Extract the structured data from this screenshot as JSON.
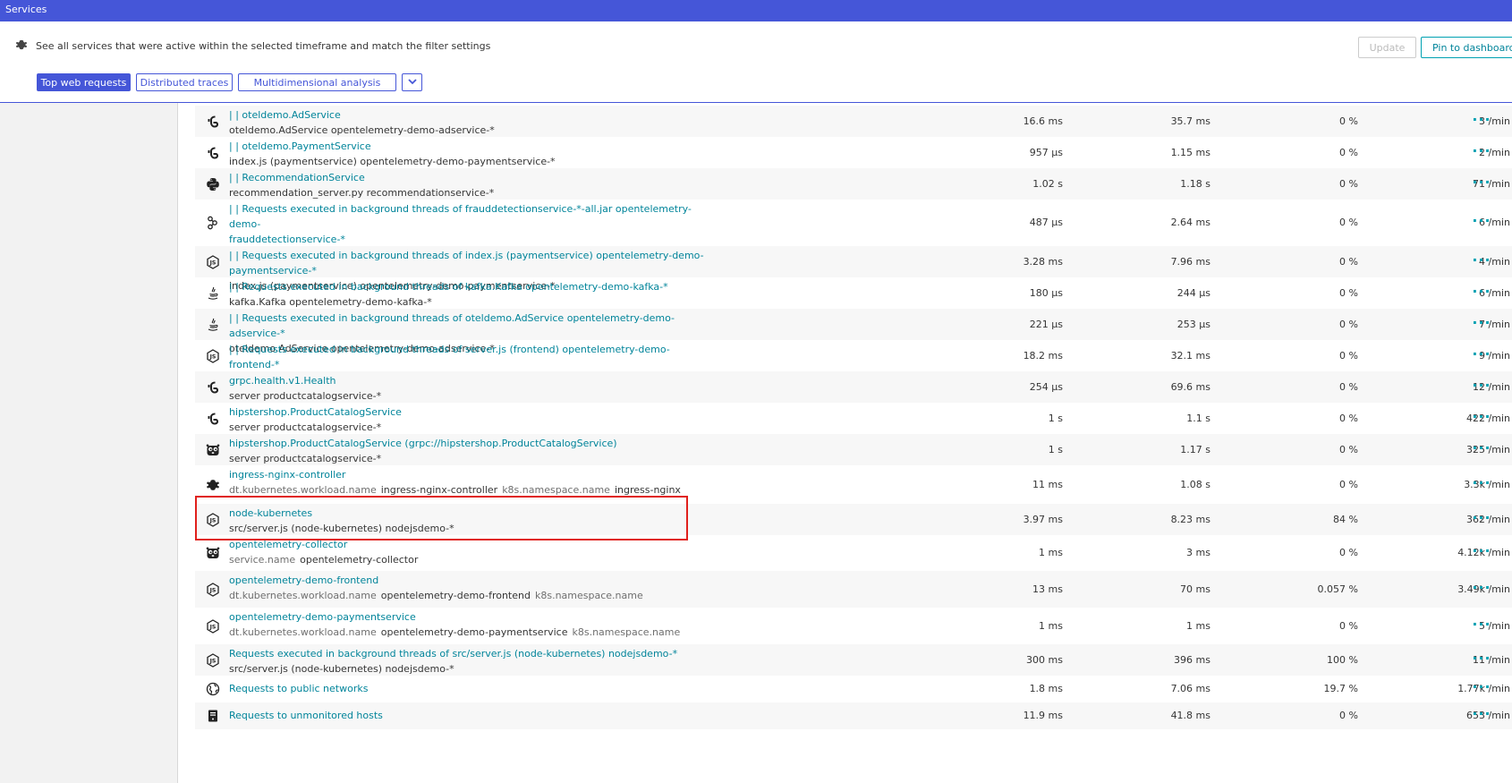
{
  "topbar": {
    "title": "Services"
  },
  "header": {
    "description": "See all services that were active within the selected timeframe and match the filter settings",
    "update_label": "Update",
    "pin_label": "Pin to dashboard",
    "tabs": [
      {
        "label": "Top web requests"
      },
      {
        "label": "Distributed traces"
      },
      {
        "label": "Multidimensional analysis"
      }
    ]
  },
  "colors": {
    "brand": "#4556d8",
    "link": "#00849a",
    "highlight": "#e0201c"
  },
  "rows": [
    {
      "icon": "grpc-icon",
      "name": "| | oteldemo.AdService",
      "sub": "oteldemo.AdService opentelemetry-demo-adservice-*",
      "c1": "16.6 ms",
      "c2": "35.7 ms",
      "c3": "0 %",
      "c4": "3 /min"
    },
    {
      "icon": "grpc-icon",
      "name": "| | oteldemo.PaymentService",
      "sub": "index.js (paymentservice) opentelemetry-demo-paymentservice-*",
      "c1": "957 µs",
      "c2": "1.15 ms",
      "c3": "0 %",
      "c4": "2 /min"
    },
    {
      "icon": "python-icon",
      "name": "| | RecommendationService",
      "sub": "recommendation_server.py recommendationservice-*",
      "c1": "1.02 s",
      "c2": "1.18 s",
      "c3": "0 %",
      "c4": "71 /min"
    },
    {
      "icon": "kotlin-icon",
      "name": "| | Requests executed in background threads of frauddetectionservice-*-all.jar opentelemetry-demo-",
      "name2": "frauddetectionservice-*",
      "sub": "frauddetectionservice-*-all.jar opentelemetry-demo-frauddetectionservice-*",
      "c1": "487 µs",
      "c2": "2.64 ms",
      "c3": "0 %",
      "c4": "6 /min"
    },
    {
      "icon": "nodejs-icon",
      "name": "| | Requests executed in background threads of index.js (paymentservice) opentelemetry-demo-paymentservice-*",
      "sub": "index.js (paymentservice) opentelemetry-demo-paymentservice-*",
      "c1": "3.28 ms",
      "c2": "7.96 ms",
      "c3": "0 %",
      "c4": "4 /min"
    },
    {
      "icon": "java-icon",
      "name": "| | Requests executed in background threads of kafka.Kafka opentelemetry-demo-kafka-*",
      "sub": "kafka.Kafka opentelemetry-demo-kafka-*",
      "c1": "180 µs",
      "c2": "244 µs",
      "c3": "0 %",
      "c4": "6 /min"
    },
    {
      "icon": "java-icon",
      "name": "| | Requests executed in background threads of oteldemo.AdService opentelemetry-demo-adservice-*",
      "sub": "oteldemo.AdService opentelemetry-demo-adservice-*",
      "c1": "221 µs",
      "c2": "253 µs",
      "c3": "0 %",
      "c4": "7 /min"
    },
    {
      "icon": "nodejs-icon",
      "name": "| | Requests executed in background threads of server.js (frontend) opentelemetry-demo-frontend-*",
      "sub": "server.js (frontend) opentelemetry-demo-frontend-*",
      "c1": "18.2 ms",
      "c2": "32.1 ms",
      "c3": "0 %",
      "c4": "9 /min"
    },
    {
      "icon": "grpc-icon",
      "name": "grpc.health.v1.Health",
      "sub": "server productcatalogservice-*",
      "c1": "254 µs",
      "c2": "69.6 ms",
      "c3": "0 %",
      "c4": "12 /min"
    },
    {
      "icon": "grpc-icon",
      "name": "hipstershop.ProductCatalogService",
      "sub": "server productcatalogservice-*",
      "c1": "1 s",
      "c2": "1.1 s",
      "c3": "0 %",
      "c4": "422 /min"
    },
    {
      "icon": "go-icon",
      "name": "hipstershop.ProductCatalogService (grpc://hipstershop.ProductCatalogService)",
      "sub": "server productcatalogservice-*",
      "c1": "1 s",
      "c2": "1.17 s",
      "c3": "0 %",
      "c4": "325 /min"
    },
    {
      "icon": "gear-icon",
      "name": "ingress-nginx-controller",
      "k1": "dt.kubernetes.workload.name",
      "v1": "ingress-nginx-controller",
      "k2": "k8s.namespace.name",
      "v2": "ingress-nginx",
      "c1": "11 ms",
      "c2": "1.08 s",
      "c3": "0 %",
      "c4": "3.3k /min"
    },
    {
      "icon": "nodejs-icon",
      "name": "node-kubernetes",
      "sub": "src/server.js (node-kubernetes) nodejsdemo-*",
      "c1": "3.97 ms",
      "c2": "8.23 ms",
      "c3": "84 %",
      "c4": "362 /min"
    },
    {
      "icon": "go-icon",
      "name": "opentelemetry-collector",
      "k1": "service.name",
      "v1": "opentelemetry-collector",
      "c1": "1 ms",
      "c2": "3 ms",
      "c3": "0 %",
      "c4": "4.12k /min"
    },
    {
      "icon": "nodejs-icon",
      "name": "opentelemetry-demo-frontend",
      "k1": "dt.kubernetes.workload.name",
      "v1": "opentelemetry-demo-frontend",
      "k2": "k8s.namespace.name",
      "c1": "13 ms",
      "c2": "70 ms",
      "c3": "0.057 %",
      "c4": "3.49k /min"
    },
    {
      "icon": "nodejs-icon",
      "name": "opentelemetry-demo-paymentservice",
      "k1": "dt.kubernetes.workload.name",
      "v1": "opentelemetry-demo-paymentservice",
      "k2": "k8s.namespace.name",
      "c1": "1 ms",
      "c2": "1 ms",
      "c3": "0 %",
      "c4": "5 /min"
    },
    {
      "icon": "nodejs-icon",
      "name": "Requests executed in background threads of src/server.js (node-kubernetes) nodejsdemo-*",
      "sub": "src/server.js (node-kubernetes) nodejsdemo-*",
      "c1": "300 ms",
      "c2": "396 ms",
      "c3": "100 %",
      "c4": "11 /min"
    },
    {
      "icon": "globe-icon",
      "name": "Requests to public networks",
      "c1": "1.8 ms",
      "c2": "7.06 ms",
      "c3": "19.7 %",
      "c4": "1.77k /min"
    },
    {
      "icon": "server-icon",
      "name": "Requests to unmonitored hosts",
      "c1": "11.9 ms",
      "c2": "41.8 ms",
      "c3": "0 %",
      "c4": "653 /min"
    }
  ]
}
